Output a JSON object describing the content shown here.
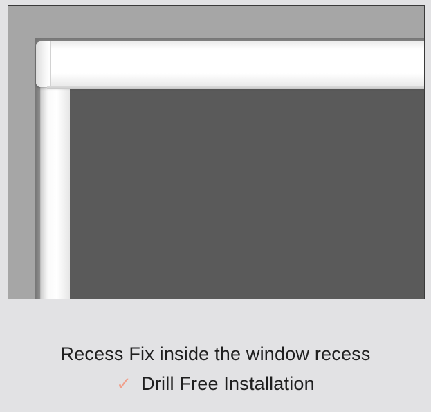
{
  "caption": {
    "fix_type": "Recess Fix inside the window recess",
    "feature": "Drill Free Installation",
    "check_icon": "check-icon",
    "check_color": "#f0a08c"
  },
  "illustration": {
    "fabric_color": "#5a5a5a",
    "wall_color": "#a6a6a6"
  }
}
